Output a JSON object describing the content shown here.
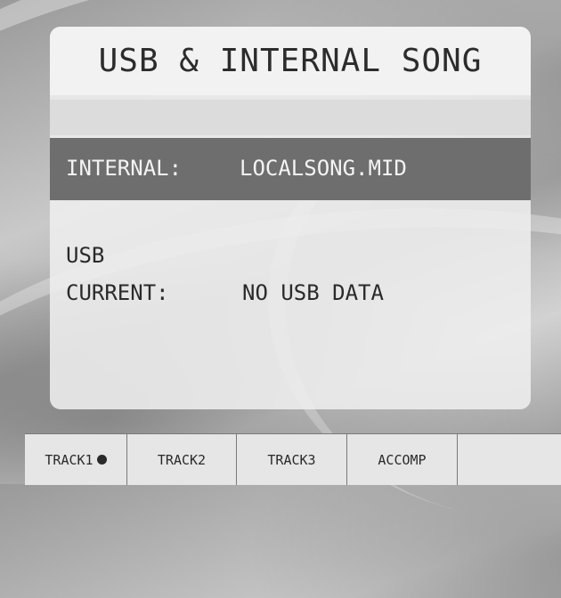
{
  "screen": {
    "title": "USB & INTERNAL SONG",
    "internal": {
      "label": "INTERNAL:",
      "value": "LOCALSONG.MID"
    },
    "usb": {
      "label": "USB",
      "current_label": "CURRENT:",
      "current_value": "NO USB DATA"
    }
  },
  "tabs": [
    {
      "label": "TRACK1",
      "active_indicator": "filled-dot-icon"
    },
    {
      "label": "TRACK2"
    },
    {
      "label": "TRACK3"
    },
    {
      "label": "ACCOMP"
    },
    {
      "label": ""
    }
  ]
}
